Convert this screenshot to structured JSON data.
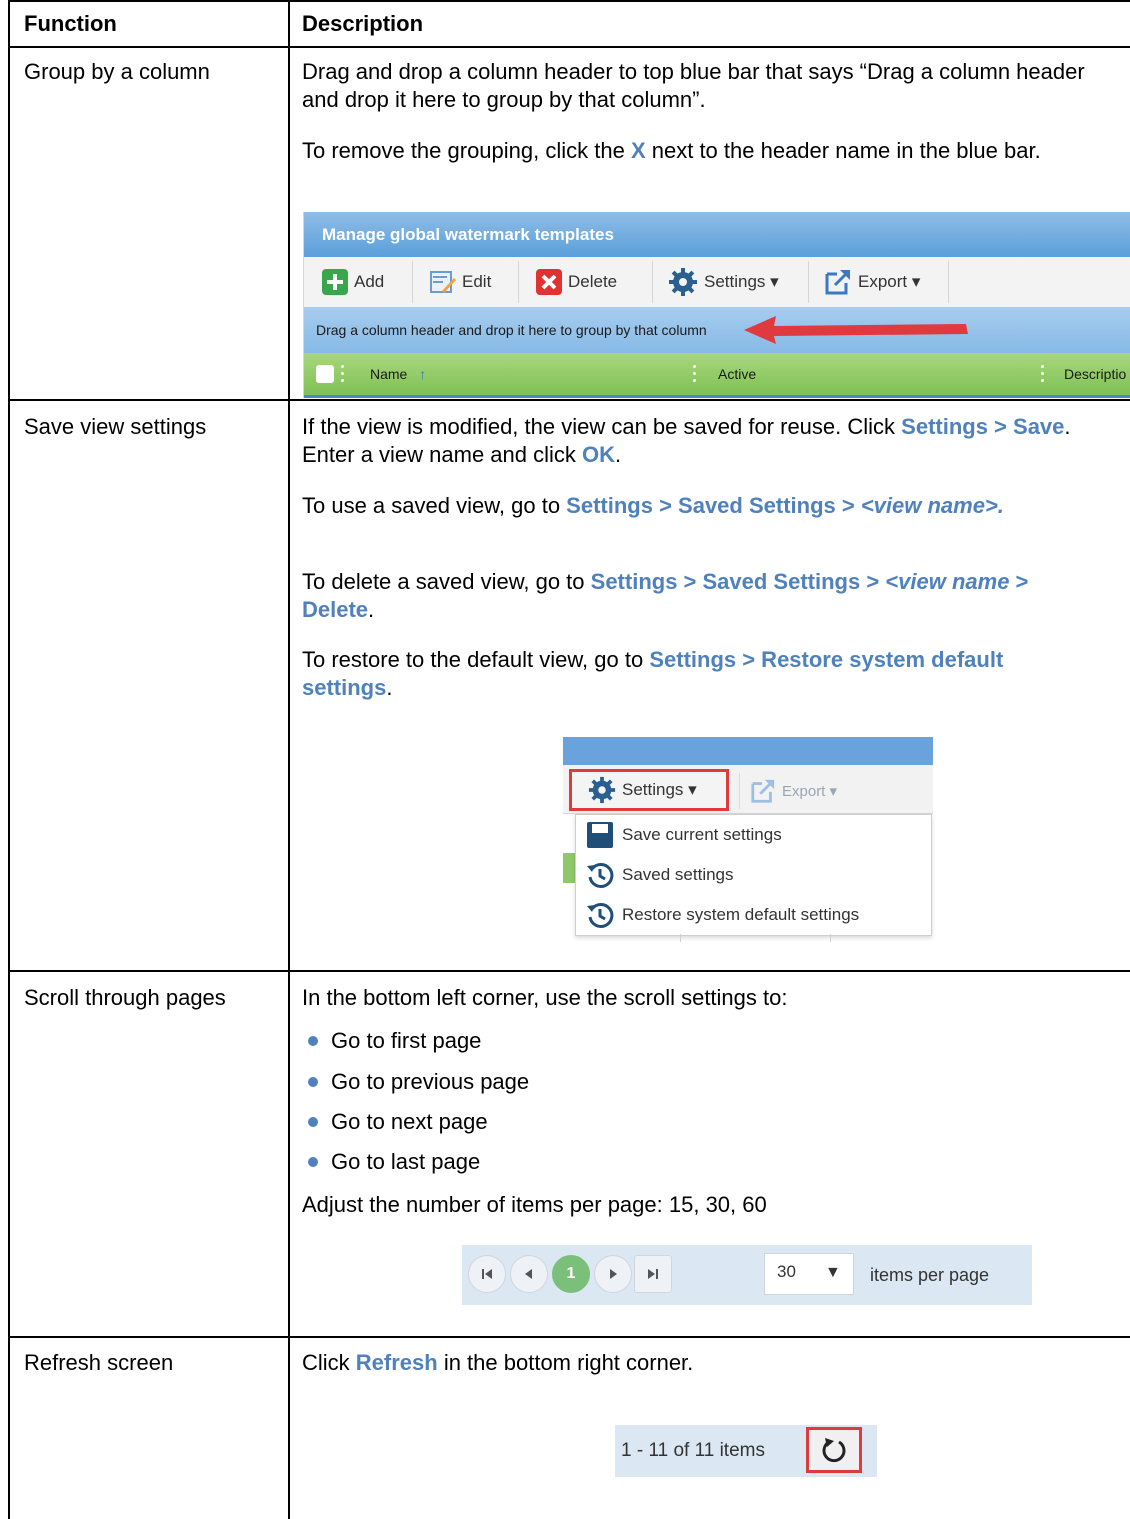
{
  "headers": {
    "function": "Function",
    "description": "Description"
  },
  "rows": [
    {
      "function": "Group by a column",
      "p1": "Drag and drop a column header to top blue bar that says “Drag a column header and drop it here to group by that column”.",
      "p2_a": "To remove the grouping, click the ",
      "p2_kw": "X",
      "p2_b": " next to the header name in the blue bar.",
      "shot": {
        "title": "Manage global watermark templates",
        "buttons": [
          "Add",
          "Edit",
          "Delete",
          "Settings ▾",
          "Export ▾"
        ],
        "group_bar": "Drag a column header and drop it here to group by that column",
        "columns": [
          "Name",
          "Active",
          "Descriptio"
        ],
        "colors": {
          "header": "#5a9fdb",
          "group_bar": "#86b9e6",
          "column_bar": "#7fc155",
          "arrow": "#e0393e"
        }
      }
    },
    {
      "function": "Save view settings",
      "p1_a": "If the view is modified, the view can be saved for reuse. Click ",
      "p1_kw1": "Settings > Save",
      "p1_b": ". Enter a view name and click ",
      "p1_kw2": "OK",
      "p1_c": ".",
      "p2_a": "To use a saved view, go to ",
      "p2_kw": "Settings > Saved Settings > ",
      "p2_kwi": "<view name>.",
      "p3_a": "To delete a saved view, go to ",
      "p3_kw": "Settings > Saved Settings > ",
      "p3_kwi": "<view name",
      "p3_kw2": " > Delete",
      "p3_b": ".",
      "p4_a": "To restore to the default view, go to ",
      "p4_kw": "Settings > Restore system default settings",
      "p4_b": ".",
      "shot": {
        "settings": "Settings ▾",
        "export": "Export ▾",
        "menu": [
          "Save current settings",
          "Saved settings",
          "Restore system default settings"
        ]
      }
    },
    {
      "function": "Scroll through pages",
      "intro": "In the bottom left corner, use the scroll settings to:",
      "bullets": [
        "Go to first page",
        "Go to previous page",
        "Go to next page",
        "Go to last page"
      ],
      "items_note": "Adjust the number of items per page: 15, 30, 60",
      "shot": {
        "current_page": "1",
        "per_page": "30",
        "per_page_label": "items per page"
      }
    },
    {
      "function": "Refresh screen",
      "p_a": "Click ",
      "p_kw": "Refresh",
      "p_b": " in the bottom right corner.",
      "shot": {
        "items": "1 - 11 of 11 items"
      }
    }
  ]
}
